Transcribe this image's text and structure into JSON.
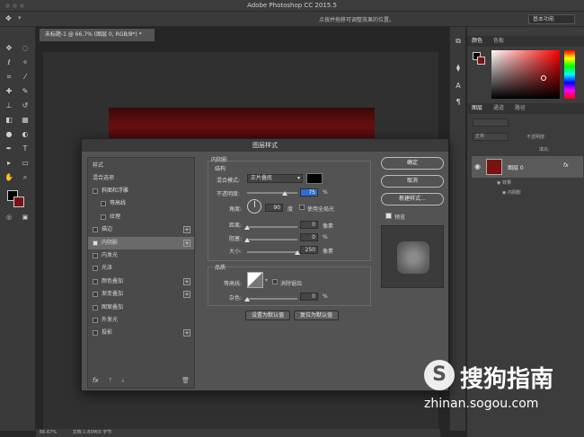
{
  "app": {
    "title": "Adobe Photoshop CC 2015.5",
    "option_hint": "点按并拖移可调整效果的位置。",
    "workspace": "基本功能"
  },
  "document": {
    "tab": "未标题-1 @ 66.7% (图层 0, RGB/8*) *",
    "zoom": "66.67%",
    "doc_info": "文档:1.83M/0 字节",
    "layer_color": "#7a1212"
  },
  "right_panel": {
    "color_tabs": [
      "颜色",
      "色板"
    ],
    "layers_tabs": [
      "图层",
      "通道",
      "路径"
    ],
    "blend": "正常",
    "opacity_label": "不透明度:",
    "fill_label": "填充:",
    "layer_name": "图层 0",
    "fx": "fx",
    "effects_label": "效果",
    "effect_item": "内阴影"
  },
  "dialog": {
    "title": "图层样式",
    "styles_header": "样式",
    "blend_options": "混合选项",
    "style_items": [
      {
        "label": "斜面和浮雕",
        "checked": false,
        "plus": false,
        "indent": false
      },
      {
        "label": "等高线",
        "checked": false,
        "plus": false,
        "indent": true
      },
      {
        "label": "纹理",
        "checked": false,
        "plus": false,
        "indent": true
      },
      {
        "label": "描边",
        "checked": false,
        "plus": true,
        "indent": false
      },
      {
        "label": "内阴影",
        "checked": true,
        "plus": true,
        "indent": false,
        "selected": true
      },
      {
        "label": "内发光",
        "checked": false,
        "plus": false,
        "indent": false
      },
      {
        "label": "光泽",
        "checked": false,
        "plus": false,
        "indent": false
      },
      {
        "label": "颜色叠加",
        "checked": false,
        "plus": true,
        "indent": false
      },
      {
        "label": "渐变叠加",
        "checked": false,
        "plus": true,
        "indent": false
      },
      {
        "label": "图案叠加",
        "checked": false,
        "plus": false,
        "indent": false
      },
      {
        "label": "外发光",
        "checked": false,
        "plus": false,
        "indent": false
      },
      {
        "label": "投影",
        "checked": false,
        "plus": true,
        "indent": false
      }
    ],
    "footer_fx": "fx",
    "inner_shadow": {
      "section": "内阴影",
      "structure": "结构",
      "blend_mode_label": "混合模式:",
      "blend_mode": "正片叠底",
      "opacity_label": "不透明度:",
      "opacity": 75,
      "unit_pct": "%",
      "angle_label": "角度:",
      "angle": 90,
      "angle_unit": "度",
      "global_light": "使用全局光",
      "distance_label": "距离:",
      "distance": 0,
      "choke_label": "阻塞:",
      "choke": 0,
      "size_label": "大小:",
      "size": 250,
      "unit_px": "像素",
      "quality": "品质",
      "contour_label": "等高线:",
      "antialias": "消除锯齿",
      "noise_label": "杂色:",
      "noise": 0,
      "set_default": "设置为默认值",
      "reset_default": "复位为默认值"
    },
    "buttons": {
      "ok": "确定",
      "cancel": "取消",
      "new_style": "新建样式...",
      "preview": "预览"
    }
  },
  "watermark": {
    "brand": "搜狗指南",
    "url": "zhinan.sogou.com"
  }
}
